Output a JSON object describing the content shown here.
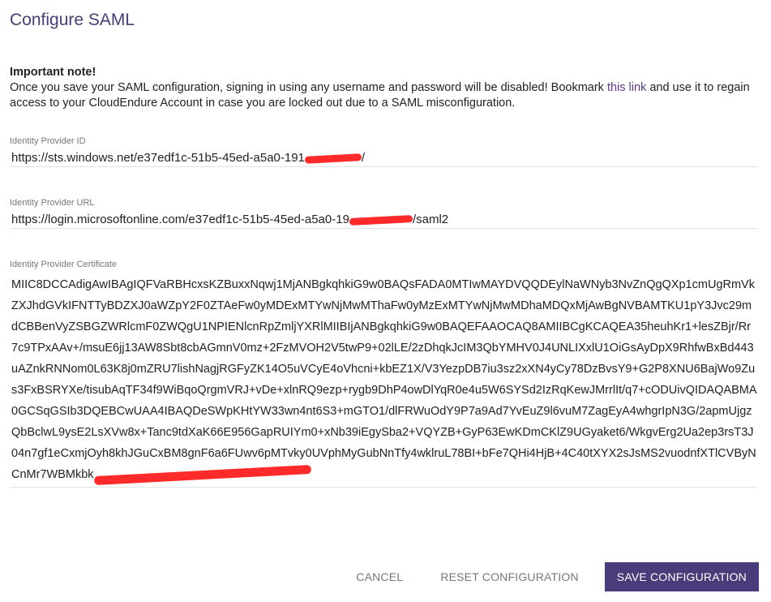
{
  "header": {
    "title": "Configure SAML"
  },
  "note": {
    "title": "Important note!",
    "text_before_link": "Once you save your SAML configuration, signing in using any username and password will be disabled!  Bookmark ",
    "link_text": "this link",
    "text_after_link": " and use it to regain access to your CloudEndure Account in case you are locked out due to a SAML misconfiguration."
  },
  "fields": {
    "idp_id": {
      "label": "Identity Provider ID",
      "value_prefix": "https://sts.windows.net/e37edf1c-51b5-45ed-a5a0-191",
      "value_suffix": "/"
    },
    "idp_url": {
      "label": "Identity Provider URL",
      "value_prefix": "https://login.microsoftonline.com/e37edf1c-51b5-45ed-a5a0-19",
      "value_suffix": "/saml2"
    },
    "idp_cert": {
      "label": "Identity Provider Certificate",
      "value_prefix": "MIIC8DCCAdigAwIBAgIQFVaRBHcxsKZBuxxNqwj1MjANBgkqhkiG9w0BAQsFADA0MTIwMAYDVQQDEylNaWNyb3NvZnQgQXp1cmUgRmVkZXJhdGVkIFNTTyBDZXJ0aWZpY2F0ZTAeFw0yMDExMTYwNjMwMThaFw0yMzExMTYwNjMwMDhaMDQxMjAwBgNVBAMTKU1pY3Jvc29mdCBBenVyZSBGZWRlcmF0ZWQgU1NPIENlcnRpZmljYXRlMIIBIjANBgkqhkiG9w0BAQEFAAOCAQ8AMIIBCgKCAQEA35heuhKr1+lesZBjr/Rr7c9TPxAAv+/msuE6jj13AW8Sbt8cbAGmnV0mz+2FzMVOH2V5twP9+02lLE/2zDhqkJcIM3QbYMHV0J4UNLIXxlU1OiGsAyDpX9RhfwBxBd443uAZnkRNNom0L63K8j0mZRU7lishNagjRGFyZK14O5uVCyE4oVhcni+kbEZ1X/V3YezpDB7iu3sz2xXN4yCy78DzBvsY9+G2P8XNU6BajWo9Zus3FxBSRYXe/tisubAqTF34f9WiBqoQrgmVRJ+vDe+xlnRQ9ezp+rygb9DhP4owDlYqR0e4u5W6SYSd2IzRqKewJMrrlIt/q7+cODUivQIDAQABMA0GCSqGSIb3DQEBCwUAA4IBAQDeSWpKHtYW33wn4nt6S3+mGTO1/dlFRWuOdY9P7a9Ad7YvEuZ9l6vuM7ZagEyA4whgrIpN3G/2apmUjgzQbBclwL9ysE2LsXVw8x+Tanc9tdXaK66E956GapRUIYm0+xNb39iEgySba2+VQYZB+GyP63EwKDmCKlZ9UGyaket6/WkgvErg2Ua2ep3rsT3J04n7gf1eCxmjOyh8khJGuCxBM8gnF6a6FUwv6pMTvky0UVphMyGubNnTfy4wklruL78BI+bFe7QHi4HjB+4C40tXYX2sJsMS2vuodnfXTlCVByNCnMr7WBMkbk",
      "value_suffix": ""
    }
  },
  "actions": {
    "cancel": "CANCEL",
    "reset": "RESET CONFIGURATION",
    "save": "SAVE CONFIGURATION"
  },
  "colors": {
    "accent": "#4a3b7a",
    "link": "#5b3a8e",
    "redaction": "#ff2a2a"
  }
}
